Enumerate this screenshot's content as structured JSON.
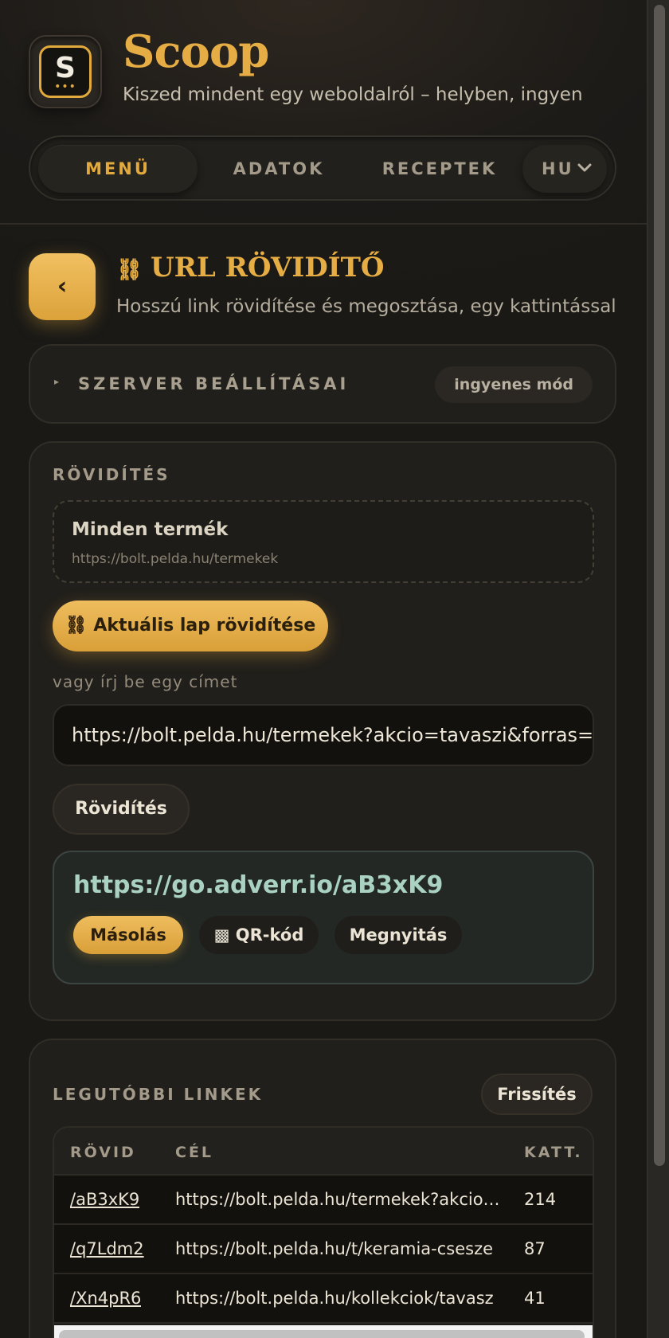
{
  "app": {
    "logo_letter": "S",
    "logo_dots": "•••",
    "title": "Scoop",
    "subtitle": "Kiszed mindent egy weboldalról – helyben, ingyen"
  },
  "nav": {
    "items": [
      {
        "label": "MENÜ",
        "active": true
      },
      {
        "label": "ADATOK",
        "active": false
      },
      {
        "label": "RECEPTEK",
        "active": false
      }
    ],
    "language": "HU",
    "language_chevron": "⌄"
  },
  "tool": {
    "back_label": "‹",
    "icon": "⛓",
    "title": "URL RÖVIDÍTŐ",
    "subtitle": "Hosszú link rövidítése és megosztása, egy kattintással"
  },
  "server": {
    "caret": "▸",
    "label": "SZERVER BEÁLLÍTÁSAI",
    "badge": "ingyenes mód"
  },
  "shorten": {
    "section_label": "RÖVIDÍTÉS",
    "current_page_title": "Minden termék",
    "current_page_url": "https://bolt.pelda.hu/termekek",
    "shorten_current_label": "⛓ Aktuális lap rövidítése",
    "or_label": "vagy írj be egy címet",
    "input_value": "https://bolt.pelda.hu/termekek?akcio=tavaszi&forras=hirlevel",
    "shorten_button": "Rövidítés",
    "result_url": "https://go.adverr.io/aB3xK9",
    "copy_label": "Másolás",
    "qr_label": "▩ QR-kód",
    "open_label": "Megnyitás"
  },
  "recent": {
    "section_label": "LEGUTÓBBI LINKEK",
    "refresh_label": "Frissítés",
    "columns": [
      "RÖVID",
      "CÉL",
      "KATT."
    ],
    "rows": [
      {
        "short": "/aB3xK9",
        "target": "https://bolt.pelda.hu/termekek?akcio=tavaszi&forras=hirlevel",
        "clicks": "214"
      },
      {
        "short": "/q7Ldm2",
        "target": "https://bolt.pelda.hu/t/keramia-csesze",
        "clicks": "87"
      },
      {
        "short": "/Xn4pR6",
        "target": "https://bolt.pelda.hu/kollekciok/tavasz",
        "clicks": "41"
      }
    ]
  },
  "colors": {
    "accent": "#e2a93d",
    "background": "#1c1a17",
    "result_text": "#a9d2c3"
  }
}
